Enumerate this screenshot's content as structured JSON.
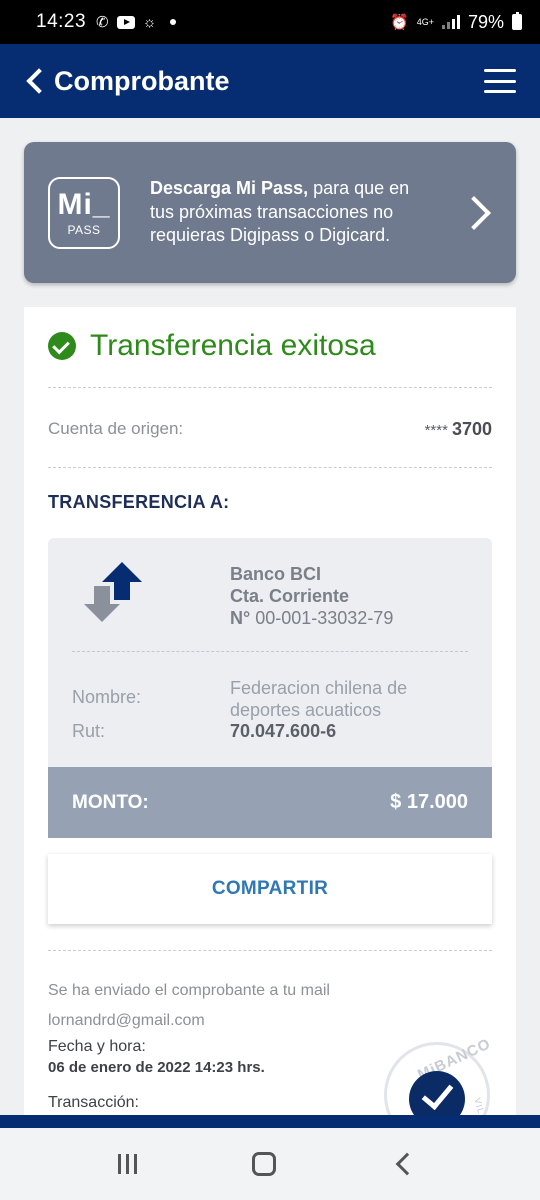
{
  "status_bar": {
    "time": "14:23",
    "net_label_top": "4G+",
    "battery": "79%"
  },
  "header": {
    "title": "Comprobante"
  },
  "banner": {
    "logo_big": "Mi_",
    "logo_small": "PASS",
    "text_bold": "Descarga Mi Pass,",
    "text_rest": " para que en tus próximas transacciones no requieras Digipass o Digicard."
  },
  "result": {
    "title": "Transferencia exitosa",
    "origin_label": "Cuenta de origen:",
    "origin_mask": "****",
    "origin_account": "3700"
  },
  "transfer_to": {
    "section_title": "TRANSFERENCIA A:",
    "bank": "Banco BCI",
    "account_type": "Cta. Corriente",
    "number_prefix": "N°",
    "account_number": "00-001-33032-79",
    "name_label": "Nombre:",
    "name_value": "Federacion chilena de deportes acuaticos",
    "rut_label": "Rut:",
    "rut_value": "70.047.600-6",
    "amount_label": "MONTO:",
    "amount_value": "$ 17.000"
  },
  "share_label": "COMPARTIR",
  "details": {
    "mail_sent": "Se ha enviado el comprobante a tu mail",
    "email": "lornandrd@gmail.com",
    "datetime_label": "Fecha y hora:",
    "datetime_value": "06 de enero de 2022 14:23 hrs.",
    "transaction_label": "Transacción:"
  },
  "seal": {
    "text": "MiBANCO",
    "side_text": "VIL"
  },
  "colors": {
    "header_bg": "#062c72",
    "success": "#2f8a1c",
    "banner_bg": "#6f7a8e",
    "share_text": "#2f78b4",
    "amount_bar": "#96a2b3"
  }
}
